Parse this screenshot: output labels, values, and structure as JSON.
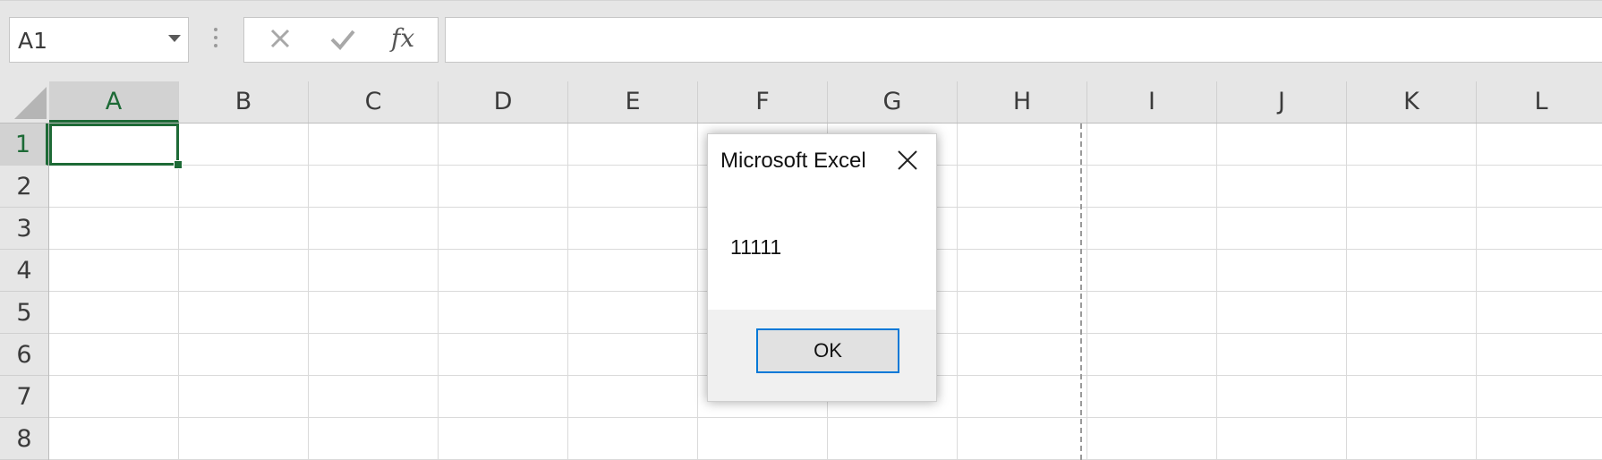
{
  "formula_bar": {
    "name_box": "A1",
    "cancel_icon": "close-icon",
    "enter_icon": "check-icon",
    "fx_label": "fx",
    "formula_value": ""
  },
  "columns": [
    "A",
    "B",
    "C",
    "D",
    "E",
    "F",
    "G",
    "H",
    "I",
    "J",
    "K",
    "L"
  ],
  "rows": [
    "1",
    "2",
    "3",
    "4",
    "5",
    "6",
    "7",
    "8"
  ],
  "selected_cell": {
    "column": "A",
    "row": "1"
  },
  "dialog": {
    "title": "Microsoft Excel",
    "message": "11111",
    "ok_label": "OK"
  },
  "colors": {
    "excel_green": "#1d6a36",
    "focus_blue": "#0078d7",
    "header_gray": "#e6e6e6"
  }
}
